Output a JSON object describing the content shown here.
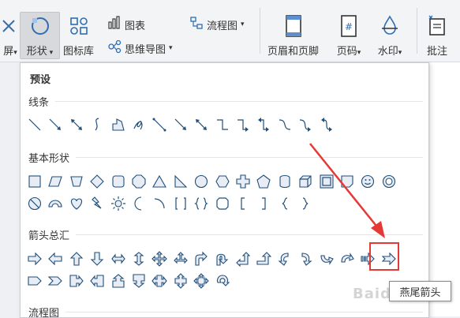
{
  "ribbon": {
    "partial_left_label": "屏",
    "shape_label": "形状",
    "icon_lib_label": "图标库",
    "chart_label": "图表",
    "mindmap_label": "思维导图",
    "flowchart_label": "流程图",
    "header_footer_label": "页眉和页脚",
    "page_number_label": "页码",
    "watermark_label": "水印",
    "comment_label": "批注"
  },
  "panel": {
    "preset_title": "预设",
    "sections": {
      "lines": "线条",
      "basic": "基本形状",
      "arrows": "箭头总汇",
      "flow": "流程图"
    }
  },
  "tooltip": {
    "text": "燕尾箭头"
  },
  "watermark": {
    "text": "Baidu经验"
  },
  "colors": {
    "accent_red": "#e53935",
    "shape_blue": "#1f4e79",
    "shape_fill": "#e8edf5"
  }
}
